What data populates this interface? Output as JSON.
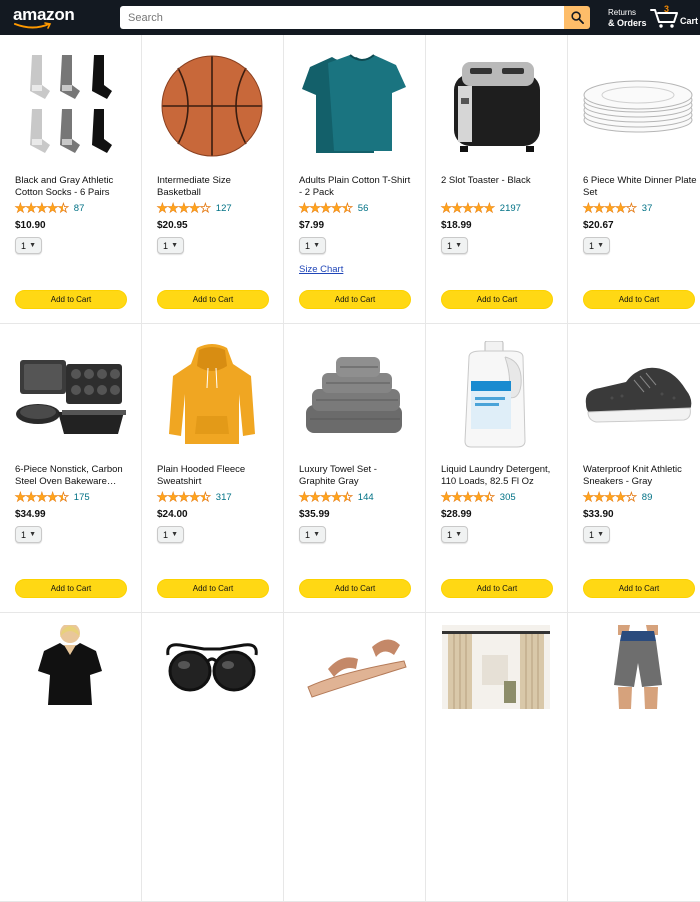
{
  "header": {
    "logo": "amazon",
    "search_placeholder": "Search",
    "returns_line1": "Returns",
    "returns_line2": "& Orders",
    "cart_count": "3",
    "cart_label": "Cart",
    "colors": {
      "bar": "#131921",
      "search_button": "#febd69",
      "cart_count": "#f08804"
    }
  },
  "colors": {
    "add_to_cart": "#ffd814",
    "star": "#ffa41c",
    "link": "#007185"
  },
  "products": [
    {
      "title": "Black and Gray Athletic Cotton Socks - 6 Pairs",
      "stars": 4.5,
      "reviews": "87",
      "price": "$10.90",
      "qty": "1",
      "button": "Add to Cart",
      "icon": "socks-icon"
    },
    {
      "title": "Intermediate Size Basketball",
      "stars": 4,
      "reviews": "127",
      "price": "$20.95",
      "qty": "1",
      "button": "Add to Cart",
      "icon": "basketball-icon"
    },
    {
      "title": "Adults Plain Cotton T-Shirt - 2 Pack",
      "stars": 4.5,
      "reviews": "56",
      "price": "$7.99",
      "qty": "1",
      "button": "Add to Cart",
      "size_chart": "Size Chart",
      "icon": "tshirt-icon"
    },
    {
      "title": "2 Slot Toaster - Black",
      "stars": 5,
      "reviews": "2197",
      "price": "$18.99",
      "qty": "1",
      "button": "Add to Cart",
      "icon": "toaster-icon"
    },
    {
      "title": "6 Piece White Dinner Plate Set",
      "stars": 4,
      "reviews": "37",
      "price": "$20.67",
      "qty": "1",
      "button": "Add to Cart",
      "icon": "plates-icon"
    },
    {
      "title": "6-Piece Nonstick, Carbon Steel Oven Bakeware…",
      "stars": 4.5,
      "reviews": "175",
      "price": "$34.99",
      "qty": "1",
      "button": "Add to Cart",
      "icon": "bakeware-icon"
    },
    {
      "title": "Plain Hooded Fleece Sweatshirt",
      "stars": 4.5,
      "reviews": "317",
      "price": "$24.00",
      "qty": "1",
      "button": "Add to Cart",
      "icon": "hoodie-icon"
    },
    {
      "title": "Luxury Towel Set - Graphite Gray",
      "stars": 4.5,
      "reviews": "144",
      "price": "$35.99",
      "qty": "1",
      "button": "Add to Cart",
      "icon": "towels-icon"
    },
    {
      "title": "Liquid Laundry Detergent, 110 Loads, 82.5 Fl Oz",
      "stars": 4.5,
      "reviews": "305",
      "price": "$28.99",
      "qty": "1",
      "button": "Add to Cart",
      "icon": "detergent-icon"
    },
    {
      "title": "Waterproof Knit Athletic Sneakers - Gray",
      "stars": 4,
      "reviews": "89",
      "price": "$33.90",
      "qty": "1",
      "button": "Add to Cart",
      "icon": "sneaker-icon"
    },
    {
      "icon": "dress-icon"
    },
    {
      "icon": "sunglasses-icon"
    },
    {
      "icon": "sandal-icon"
    },
    {
      "icon": "curtains-icon"
    },
    {
      "icon": "shorts-icon"
    }
  ]
}
